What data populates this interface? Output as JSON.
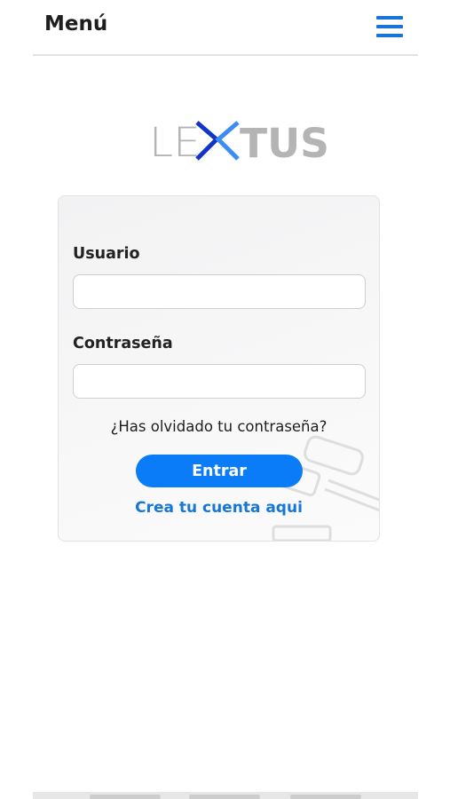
{
  "header": {
    "title": "Menú",
    "menu_icon": "hamburger-menu-icon",
    "accent_color": "#1a73d9"
  },
  "logo": {
    "text": "LEXTUS",
    "icon": "lextus-logo",
    "colors": {
      "text": "#b4b4b4",
      "arrow_dark": "#1235c8",
      "arrow_light": "#3d8bf5"
    }
  },
  "login": {
    "username_label": "Usuario",
    "username_value": "",
    "password_label": "Contraseña",
    "password_value": "",
    "forgot_password": "¿Has olvidado tu contraseña?",
    "submit_label": "Entrar",
    "create_account": "Crea tu cuenta aqui",
    "background_icon": "gavel-icon",
    "button_color": "#0a7cf7",
    "link_color": "#1677d7"
  }
}
